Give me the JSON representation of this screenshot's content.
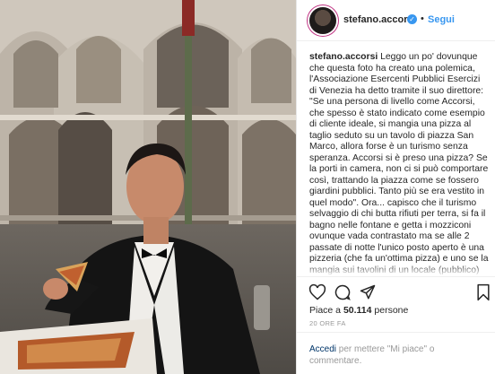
{
  "post": {
    "username": "stefano.accorsi",
    "follow_label": "Segui",
    "separator": "•",
    "verified_glyph": "✓"
  },
  "caption": {
    "username": "stefano.accorsi",
    "text": " Leggo un po' dovunque che questa foto ha creato una polemica, l'Associazione Esercenti Pubblici Esercizi di Venezia ha detto tramite il suo direttore: \"Se una persona di livello come Accorsi, che spesso è stato indicato come esempio di cliente ideale, si mangia una pizza al taglio seduto su un tavolo di piazza San Marco, allora forse è un turismo senza speranza. Accorsi si è preso una pizza? Se la porti in camera, non ci si può comportare così, trattando la piazza come se fossero giardini pubblici. Tanto più se era vestito in quel modo\". Ora... capisco che il turismo selvaggio di chi butta rifiuti per terra, si fa il bagno nelle fontane e getta i mozziconi ovunque vada contrastato ma se alle 2 passate di notte l'unico posto aperto è una pizzeria (che fa un'ottima pizza) e uno se la mangia sui tavolini di un locale (pubblico) chiuso, in una delle piazze più belle del mondo"
  },
  "actions": {
    "like_icon": "heart-icon",
    "comment_icon": "comment-icon",
    "share_icon": "share-icon",
    "save_icon": "bookmark-icon"
  },
  "likes": {
    "prefix": "Piace a ",
    "count": "50.114",
    "suffix": " persone"
  },
  "time": "20 ORE FA",
  "login": {
    "link_text": "Accedi",
    "rest_text": " per mettere \"Mi piace\" o commentare."
  },
  "colors": {
    "accent": "#3897f0",
    "text": "#262626",
    "muted": "#999999",
    "link": "#003569"
  }
}
